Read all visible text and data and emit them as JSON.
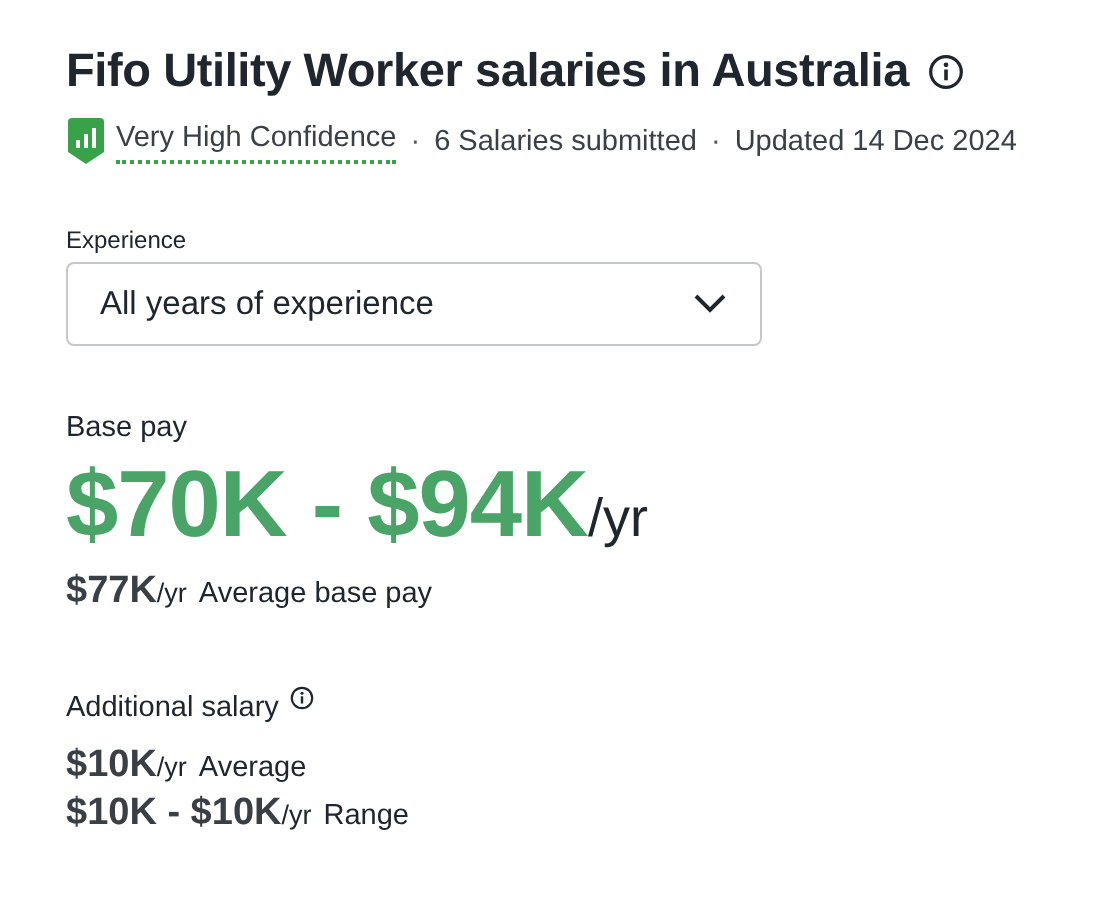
{
  "title": "Fifo Utility Worker salaries in Australia",
  "meta": {
    "confidence": "Very High Confidence",
    "submitted": "6 Salaries submitted",
    "updated": "Updated 14 Dec 2024",
    "separator": "·"
  },
  "experience": {
    "label": "Experience",
    "value": "All years of experience"
  },
  "base_pay": {
    "label": "Base pay",
    "range": "$70K - $94K",
    "unit": "/yr",
    "average": {
      "amount": "$77K",
      "unit": "/yr",
      "label": "Average base pay"
    }
  },
  "additional_salary": {
    "label": "Additional salary",
    "rows": [
      {
        "amount": "$10K",
        "unit": "/yr",
        "label": "Average"
      },
      {
        "amount": "$10K - $10K",
        "unit": "/yr",
        "label": "Range"
      }
    ]
  }
}
